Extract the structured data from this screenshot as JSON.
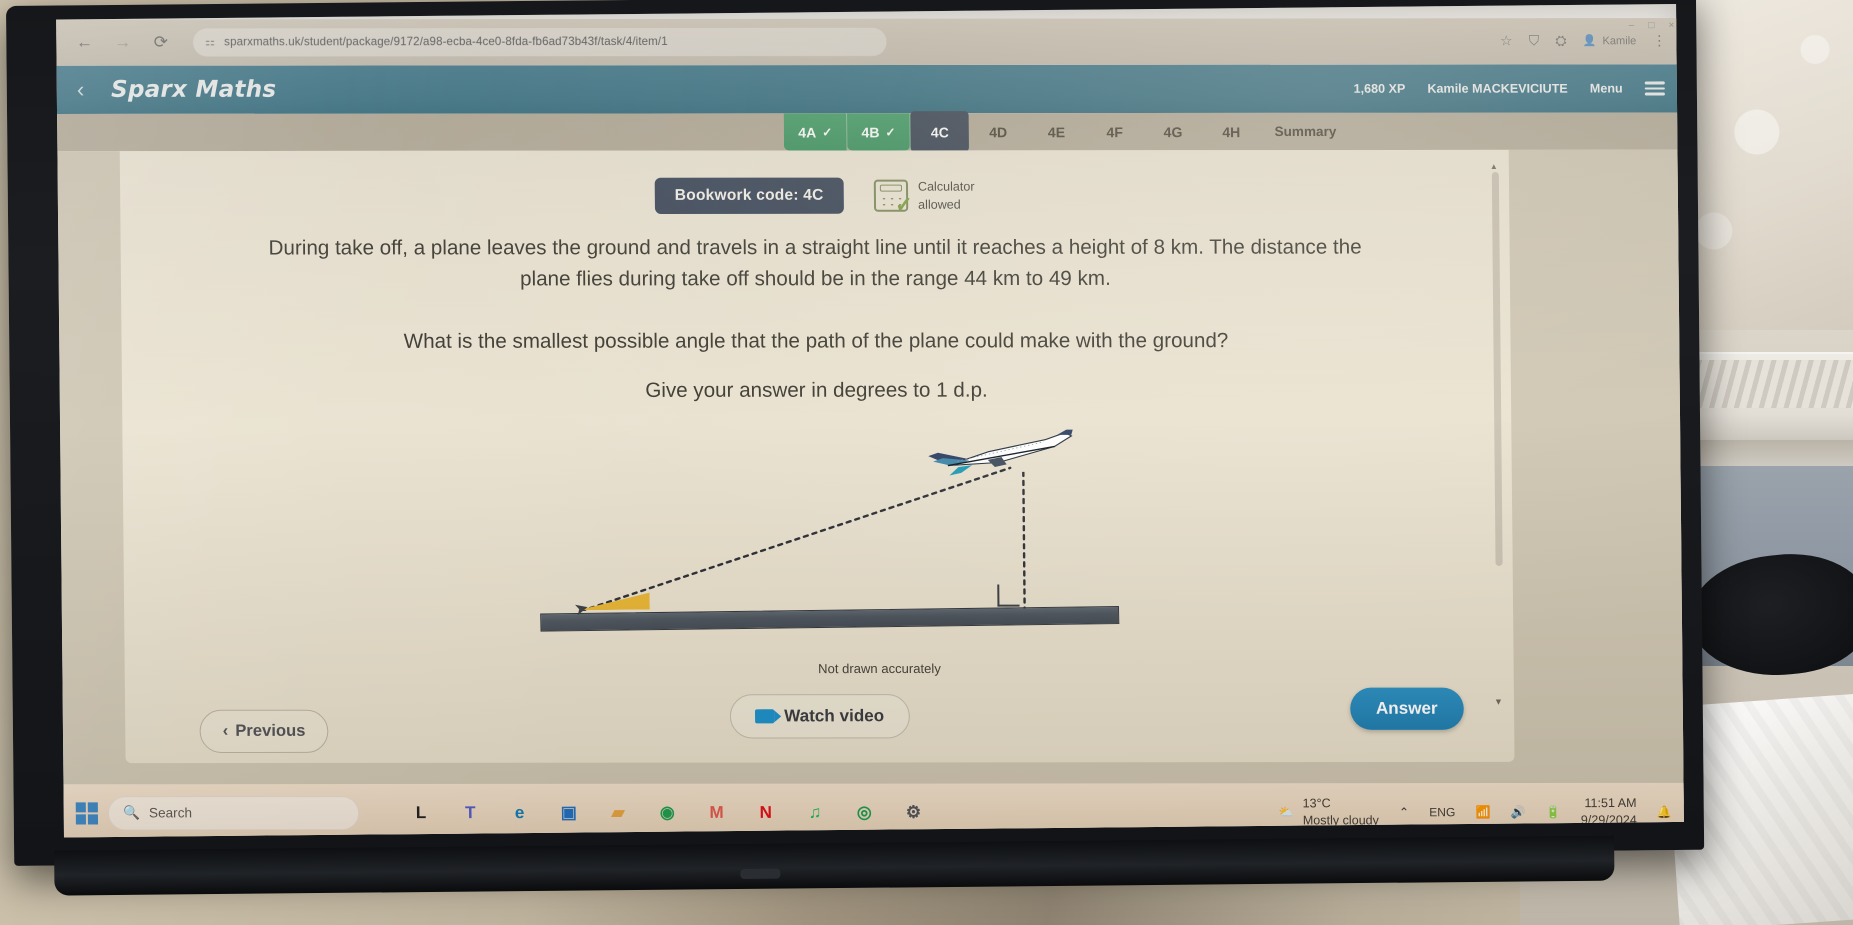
{
  "browser": {
    "back_icon": "back-arrow-icon",
    "forward_icon": "forward-arrow-icon",
    "reload_icon": "reload-icon",
    "url": "sparxmaths.uk/student/package/9172/a98-ecba-4ce0-8fda-fb6ad73b43f/task/4/item/1",
    "url_lock_icon": "site-settings-icon",
    "favourite_icon": "star-icon",
    "collections_icon": "collections-icon",
    "extensions_icon": "extensions-icon",
    "profile_name": "Kamile",
    "window_minimize": "–",
    "window_maximize": "□",
    "window_close": "×"
  },
  "app": {
    "back_label": "‹",
    "title": "Sparx Maths",
    "xp": "1,680 XP",
    "user": "Kamile MACKEVICIUTE",
    "menu_label": "Menu"
  },
  "tabs": [
    {
      "label": "4A",
      "state": "done",
      "check": "✓"
    },
    {
      "label": "4B",
      "state": "done",
      "check": "✓"
    },
    {
      "label": "4C",
      "state": "active",
      "check": ""
    },
    {
      "label": "4D",
      "state": "plain",
      "check": ""
    },
    {
      "label": "4E",
      "state": "plain",
      "check": ""
    },
    {
      "label": "4F",
      "state": "plain",
      "check": ""
    },
    {
      "label": "4G",
      "state": "plain",
      "check": ""
    },
    {
      "label": "4H",
      "state": "plain",
      "check": ""
    },
    {
      "label": "Summary",
      "state": "plain",
      "check": ""
    }
  ],
  "question": {
    "bookwork_code": "Bookwork code: 4C",
    "calculator_line1": "Calculator",
    "calculator_line2": "allowed",
    "paragraph1": "During take off, a plane leaves the ground and travels in a straight line until it reaches a height of 8 km. The distance the plane flies during take off should be in the range 44 km to 49 km.",
    "paragraph2": "What is the smallest possible angle that the path of the plane could make with the ground?",
    "paragraph3": "Give your answer in degrees to 1 d.p.",
    "diagram_caption": "Not drawn accurately"
  },
  "actions": {
    "previous": "Previous",
    "previous_chevron": "‹",
    "watch_video": "Watch video",
    "answer": "Answer"
  },
  "taskbar": {
    "search_placeholder": "Search",
    "apps": [
      {
        "name": "libreoffice-icon",
        "glyph": "L",
        "color": "#1a1a1a"
      },
      {
        "name": "microsoft-teams-icon",
        "glyph": "T",
        "color": "#5059c9"
      },
      {
        "name": "microsoft-edge-icon",
        "glyph": "e",
        "color": "#0f7ab5"
      },
      {
        "name": "microsoft-store-icon",
        "glyph": "▣",
        "color": "#1b6ec2"
      },
      {
        "name": "file-explorer-icon",
        "glyph": "▰",
        "color": "#e8a33d"
      },
      {
        "name": "google-chrome-icon",
        "glyph": "◉",
        "color": "#1a9c4d"
      },
      {
        "name": "firefox-icon",
        "glyph": "M",
        "color": "#e2574c"
      },
      {
        "name": "netflix-icon",
        "glyph": "N",
        "color": "#e50914"
      },
      {
        "name": "spotify-icon",
        "glyph": "♫",
        "color": "#1db954"
      },
      {
        "name": "chrome-edit-icon",
        "glyph": "◎",
        "color": "#1a9c4d"
      },
      {
        "name": "settings-gear-icon",
        "glyph": "⚙",
        "color": "#4d5157"
      }
    ],
    "tray": {
      "temperature": "13°C",
      "weather": "Mostly cloudy",
      "show_hidden": "⌃",
      "language": "ENG",
      "wifi_icon": "wifi-icon",
      "volume_icon": "speaker-icon",
      "battery_icon": "battery-icon",
      "time": "11:51 AM",
      "date": "9/29/2024",
      "notification_icon": "bell-icon"
    }
  },
  "colors": {
    "sparx_header": "#347085",
    "tab_active": "#3b4656",
    "tab_done": "#3d9461",
    "answer_button": "#1d7db0",
    "ground": "#4d555e",
    "angle_wedge": "#e8b534"
  }
}
